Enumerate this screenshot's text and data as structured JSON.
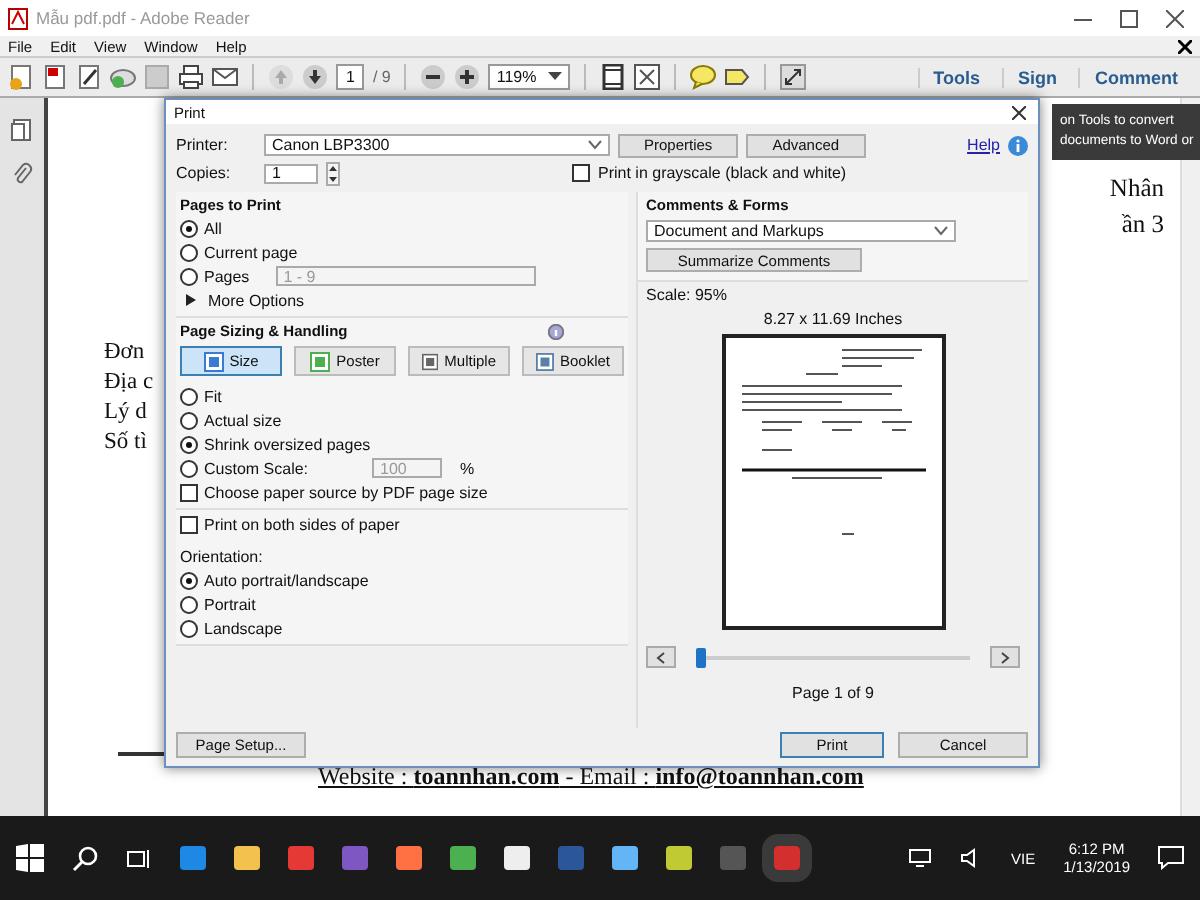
{
  "window": {
    "title": "Mẫu pdf.pdf - Adobe Reader"
  },
  "menu": [
    "File",
    "Edit",
    "View",
    "Window",
    "Help"
  ],
  "toolbar": {
    "page": "1",
    "page_total": "/ 9",
    "zoom": "119%",
    "links": [
      "Tools",
      "Sign",
      "Comment"
    ]
  },
  "tooltip": [
    "on Tools to convert",
    "documents to Word or"
  ],
  "document": {
    "left_lines": [
      "Đơn",
      "Địa c",
      "Lý d",
      "Số tì"
    ],
    "right_lines": [
      "Nhân",
      "ần 3"
    ],
    "footer": "Website : **toannhan.com** - Email : **info@toannhan.com**"
  },
  "dialog": {
    "title": "Print",
    "printer_label": "Printer:",
    "printer": "Canon LBP3300",
    "properties": "Properties",
    "advanced": "Advanced",
    "help": "Help",
    "copies_label": "Copies:",
    "copies": "1",
    "grayscale": {
      "label": "Print in grayscale (black and white)",
      "checked": false
    },
    "pages": {
      "title": "Pages to Print",
      "options": [
        {
          "label": "All",
          "selected": true
        },
        {
          "label": "Current page",
          "selected": false
        },
        {
          "label": "Pages",
          "selected": false,
          "field": "1 - 9"
        }
      ],
      "more": "More Options"
    },
    "sizing": {
      "title": "Page Sizing & Handling",
      "modes": [
        {
          "label": "Size",
          "kind": "size",
          "selected": true
        },
        {
          "label": "Poster",
          "kind": "poster",
          "selected": false
        },
        {
          "label": "Multiple",
          "kind": "multiple",
          "selected": false
        },
        {
          "label": "Booklet",
          "kind": "booklet",
          "selected": false
        }
      ],
      "options": [
        {
          "label": "Fit",
          "selected": false
        },
        {
          "label": "Actual size",
          "selected": false
        },
        {
          "label": "Shrink oversized pages",
          "selected": true
        },
        {
          "label": "Custom Scale:",
          "selected": false,
          "field": "100",
          "unit": "%"
        }
      ],
      "source": {
        "label": "Choose paper source by PDF page size",
        "checked": false
      }
    },
    "both_sides": {
      "label": "Print on both sides of paper",
      "checked": false
    },
    "orientation": {
      "label": "Orientation:",
      "options": [
        {
          "label": "Auto portrait/landscape",
          "selected": true
        },
        {
          "label": "Portrait",
          "selected": false
        },
        {
          "label": "Landscape",
          "selected": false
        }
      ]
    },
    "comments": {
      "title": "Comments & Forms",
      "value": "Document and Markups",
      "summarize": "Summarize Comments",
      "scale": "Scale: 95%",
      "paper": "8.27 x 11.69 Inches",
      "page_label": "Page 1 of 9",
      "level": 0
    },
    "page_setup": "Page Setup...",
    "print": "Print",
    "cancel": "Cancel"
  },
  "taskbar": {
    "language": "VIE",
    "time": "6:12 PM",
    "date": "1/13/2019"
  }
}
